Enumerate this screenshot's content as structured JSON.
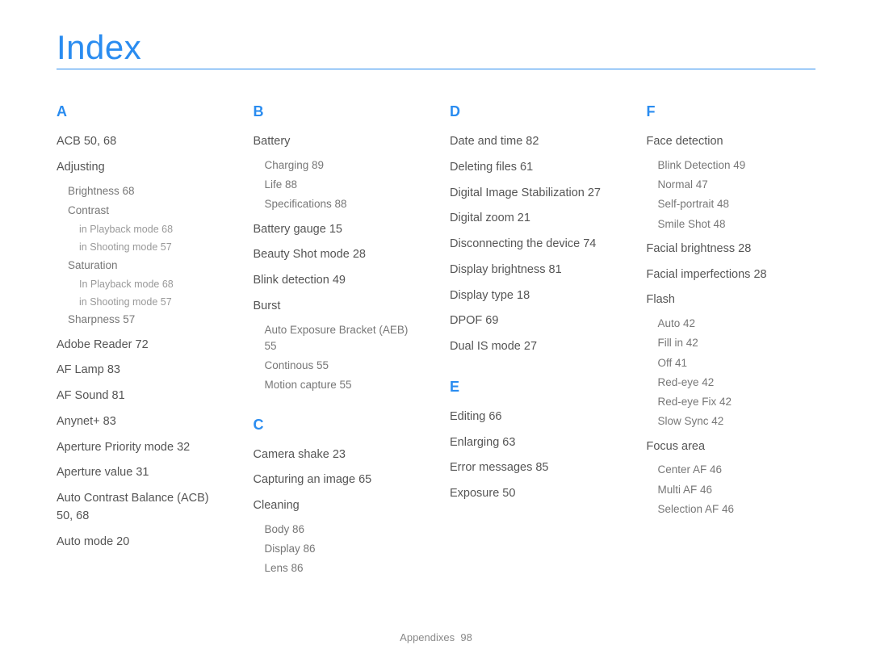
{
  "title": "Index",
  "footer": {
    "label": "Appendixes",
    "page": "98"
  },
  "col1": {
    "A": {
      "letter": "A",
      "items": [
        {
          "t": "ACB",
          "p": "50, 68"
        },
        {
          "t": "Adjusting",
          "children": [
            {
              "t": "Brightness",
              "p": "68"
            },
            {
              "t": "Contrast",
              "children": [
                {
                  "t": "in Playback mode",
                  "p": "68"
                },
                {
                  "t": "in Shooting mode",
                  "p": "57"
                }
              ]
            },
            {
              "t": "Saturation",
              "children": [
                {
                  "t": "In Playback mode",
                  "p": "68"
                },
                {
                  "t": "in Shooting mode",
                  "p": "57"
                }
              ]
            },
            {
              "t": "Sharpness",
              "p": "57"
            }
          ]
        },
        {
          "t": "Adobe Reader",
          "p": "72"
        },
        {
          "t": "AF Lamp",
          "p": "83"
        },
        {
          "t": "AF Sound",
          "p": "81"
        },
        {
          "t": "Anynet+",
          "p": "83"
        },
        {
          "t": "Aperture Priority mode",
          "p": "32"
        },
        {
          "t": "Aperture value",
          "p": "31"
        },
        {
          "t": "Auto Contrast Balance (ACB)",
          "p": "50, 68"
        },
        {
          "t": "Auto mode",
          "p": "20"
        }
      ]
    }
  },
  "col2": {
    "B": {
      "letter": "B",
      "items": [
        {
          "t": "Battery",
          "children": [
            {
              "t": "Charging",
              "p": "89"
            },
            {
              "t": "Life",
              "p": "88"
            },
            {
              "t": "Specifications",
              "p": "88"
            }
          ]
        },
        {
          "t": "Battery gauge",
          "p": "15"
        },
        {
          "t": "Beauty Shot mode",
          "p": "28"
        },
        {
          "t": "Blink detection",
          "p": "49"
        },
        {
          "t": "Burst",
          "children": [
            {
              "t": "Auto Exposure Bracket (AEB)",
              "p": "55"
            },
            {
              "t": "Continous",
              "p": "55"
            },
            {
              "t": "Motion capture",
              "p": "55"
            }
          ]
        }
      ]
    },
    "C": {
      "letter": "C",
      "items": [
        {
          "t": "Camera shake",
          "p": "23"
        },
        {
          "t": "Capturing an image",
          "p": "65"
        },
        {
          "t": "Cleaning",
          "children": [
            {
              "t": "Body",
              "p": "86"
            },
            {
              "t": "Display",
              "p": "86"
            },
            {
              "t": "Lens",
              "p": "86"
            }
          ]
        }
      ]
    }
  },
  "col3": {
    "D": {
      "letter": "D",
      "items": [
        {
          "t": "Date and time",
          "p": "82"
        },
        {
          "t": "Deleting files",
          "p": "61"
        },
        {
          "t": "Digital Image Stabilization",
          "p": "27"
        },
        {
          "t": "Digital zoom",
          "p": "21"
        },
        {
          "t": "Disconnecting the device",
          "p": "74"
        },
        {
          "t": "Display brightness",
          "p": "81"
        },
        {
          "t": "Display type",
          "p": "18"
        },
        {
          "t": "DPOF",
          "p": "69"
        },
        {
          "t": "Dual IS mode",
          "p": "27"
        }
      ]
    },
    "E": {
      "letter": "E",
      "items": [
        {
          "t": "Editing",
          "p": "66"
        },
        {
          "t": "Enlarging",
          "p": "63"
        },
        {
          "t": "Error messages",
          "p": "85"
        },
        {
          "t": "Exposure",
          "p": "50"
        }
      ]
    }
  },
  "col4": {
    "F": {
      "letter": "F",
      "items": [
        {
          "t": "Face detection",
          "children": [
            {
              "t": "Blink Detection",
              "p": "49"
            },
            {
              "t": "Normal",
              "p": "47"
            },
            {
              "t": "Self-portrait",
              "p": "48"
            },
            {
              "t": "Smile Shot",
              "p": "48"
            }
          ]
        },
        {
          "t": "Facial brightness",
          "p": "28"
        },
        {
          "t": "Facial imperfections",
          "p": "28"
        },
        {
          "t": "Flash",
          "children": [
            {
              "t": "Auto",
              "p": "42"
            },
            {
              "t": "Fill in",
              "p": "42"
            },
            {
              "t": "Off",
              "p": "41"
            },
            {
              "t": "Red-eye",
              "p": "42"
            },
            {
              "t": "Red-eye Fix",
              "p": "42"
            },
            {
              "t": "Slow Sync",
              "p": "42"
            }
          ]
        },
        {
          "t": "Focus area",
          "children": [
            {
              "t": "Center AF",
              "p": "46"
            },
            {
              "t": "Multi AF",
              "p": "46"
            },
            {
              "t": "Selection AF",
              "p": "46"
            }
          ]
        }
      ]
    }
  }
}
